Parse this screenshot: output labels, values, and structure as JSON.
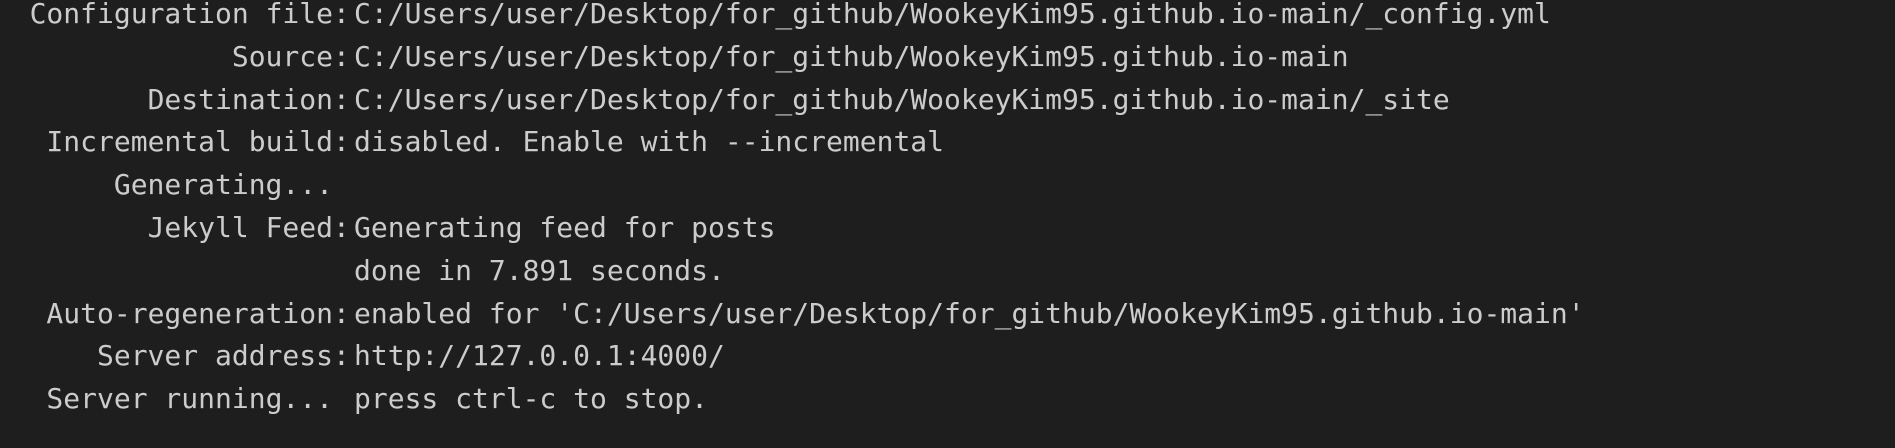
{
  "terminal": {
    "lines": [
      {
        "label": "Configuration file",
        "sep": ":",
        "value": "C:/Users/user/Desktop/for_github/WookeyKim95.github.io-main/_config.yml"
      },
      {
        "label": "Source",
        "sep": ":",
        "value": "C:/Users/user/Desktop/for_github/WookeyKim95.github.io-main"
      },
      {
        "label": "Destination",
        "sep": ":",
        "value": "C:/Users/user/Desktop/for_github/WookeyKim95.github.io-main/_site"
      },
      {
        "label": "Incremental build",
        "sep": ":",
        "value": "disabled. Enable with --incremental"
      },
      {
        "label": "Generating...",
        "sep": "",
        "value": ""
      },
      {
        "label": "Jekyll Feed",
        "sep": ":",
        "value": "Generating feed for posts"
      },
      {
        "label": "",
        "sep": "",
        "value": "done in 7.891 seconds."
      },
      {
        "label": "Auto-regeneration",
        "sep": ":",
        "value": "enabled for 'C:/Users/user/Desktop/for_github/WookeyKim95.github.io-main'"
      },
      {
        "label": "Server address",
        "sep": ":",
        "value": "http://127.0.0.1:4000/"
      },
      {
        "label": "Server running...",
        "sep": "",
        "value": "press ctrl-c to stop."
      }
    ]
  }
}
